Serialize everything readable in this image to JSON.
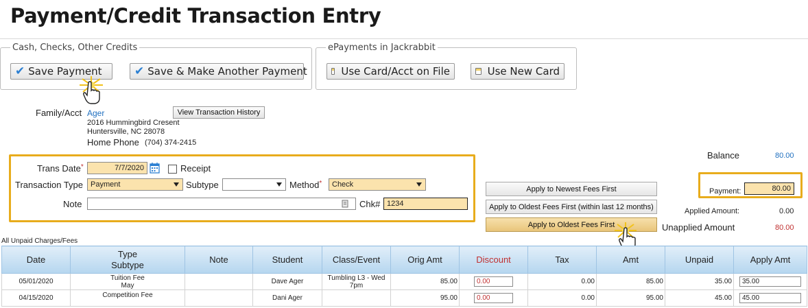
{
  "page_title": "Payment/Credit Transaction Entry",
  "group_cash": {
    "legend": "Cash, Checks, Other Credits",
    "save_label": "Save Payment",
    "save_another_label": "Save & Make Another Payment"
  },
  "group_epay": {
    "legend": "ePayments in Jackrabbit",
    "card_on_file_label": "Use Card/Acct on File",
    "new_card_label": "Use New Card"
  },
  "family": {
    "label": "Family/Acct",
    "name": "Ager",
    "address1": "2016 Hummingbird Cresent",
    "address2": "Huntersville, NC  28078",
    "home_phone_label": "Home Phone",
    "home_phone": "(704) 374-2415",
    "history_button": "View Transaction History"
  },
  "form": {
    "trans_date_label": "Trans Date",
    "trans_date": "7/7/2020",
    "receipt_label": "Receipt",
    "transaction_type_label": "Transaction Type",
    "transaction_type": "Payment",
    "subtype_label": "Subtype",
    "subtype": "",
    "method_label": "Method",
    "method": "Check",
    "note_label": "Note",
    "note": "",
    "chk_label": "Chk#",
    "chk": "1234",
    "required_mark": "*"
  },
  "apply_buttons": {
    "newest": "Apply to Newest Fees First",
    "oldest_12": "Apply to Oldest Fees First (within last 12 months)",
    "oldest": "Apply to Oldest Fees First"
  },
  "totals": {
    "balance_label": "Balance",
    "balance": "80.00",
    "payment_label": "Payment:",
    "payment": "80.00",
    "applied_label": "Applied Amount:",
    "applied": "0.00",
    "unapplied_label": "Unapplied Amount",
    "unapplied": "80.00"
  },
  "table": {
    "caption": "All Unpaid Charges/Fees",
    "headers": {
      "date": "Date",
      "type": "Type",
      "subtype": "Subtype",
      "note": "Note",
      "student": "Student",
      "class": "Class/Event",
      "orig": "Orig Amt",
      "discount": "Discount",
      "tax": "Tax",
      "amt": "Amt",
      "unpaid": "Unpaid",
      "apply": "Apply Amt"
    },
    "rows": [
      {
        "date": "05/01/2020",
        "type": "Tuition Fee",
        "subtype": "May",
        "note": "",
        "student": "Dave Ager",
        "class": "Tumbling L3 - Wed 7pm",
        "orig": "85.00",
        "discount": "0.00",
        "tax": "0.00",
        "amt": "85.00",
        "unpaid": "35.00",
        "apply": "35.00"
      },
      {
        "date": "04/15/2020",
        "type": "Competition Fee",
        "subtype": "",
        "note": "",
        "student": "Dani Ager",
        "class": "",
        "orig": "95.00",
        "discount": "0.00",
        "tax": "0.00",
        "amt": "95.00",
        "unpaid": "45.00",
        "apply": "45.00"
      }
    ]
  },
  "colors": {
    "highlight": "#e8ac1c",
    "link": "#1f6fbf",
    "check": "#2b7fd2",
    "red": "#c03030",
    "field_yellow": "#fbe3ad",
    "header_blue": "#b5d6ef"
  }
}
